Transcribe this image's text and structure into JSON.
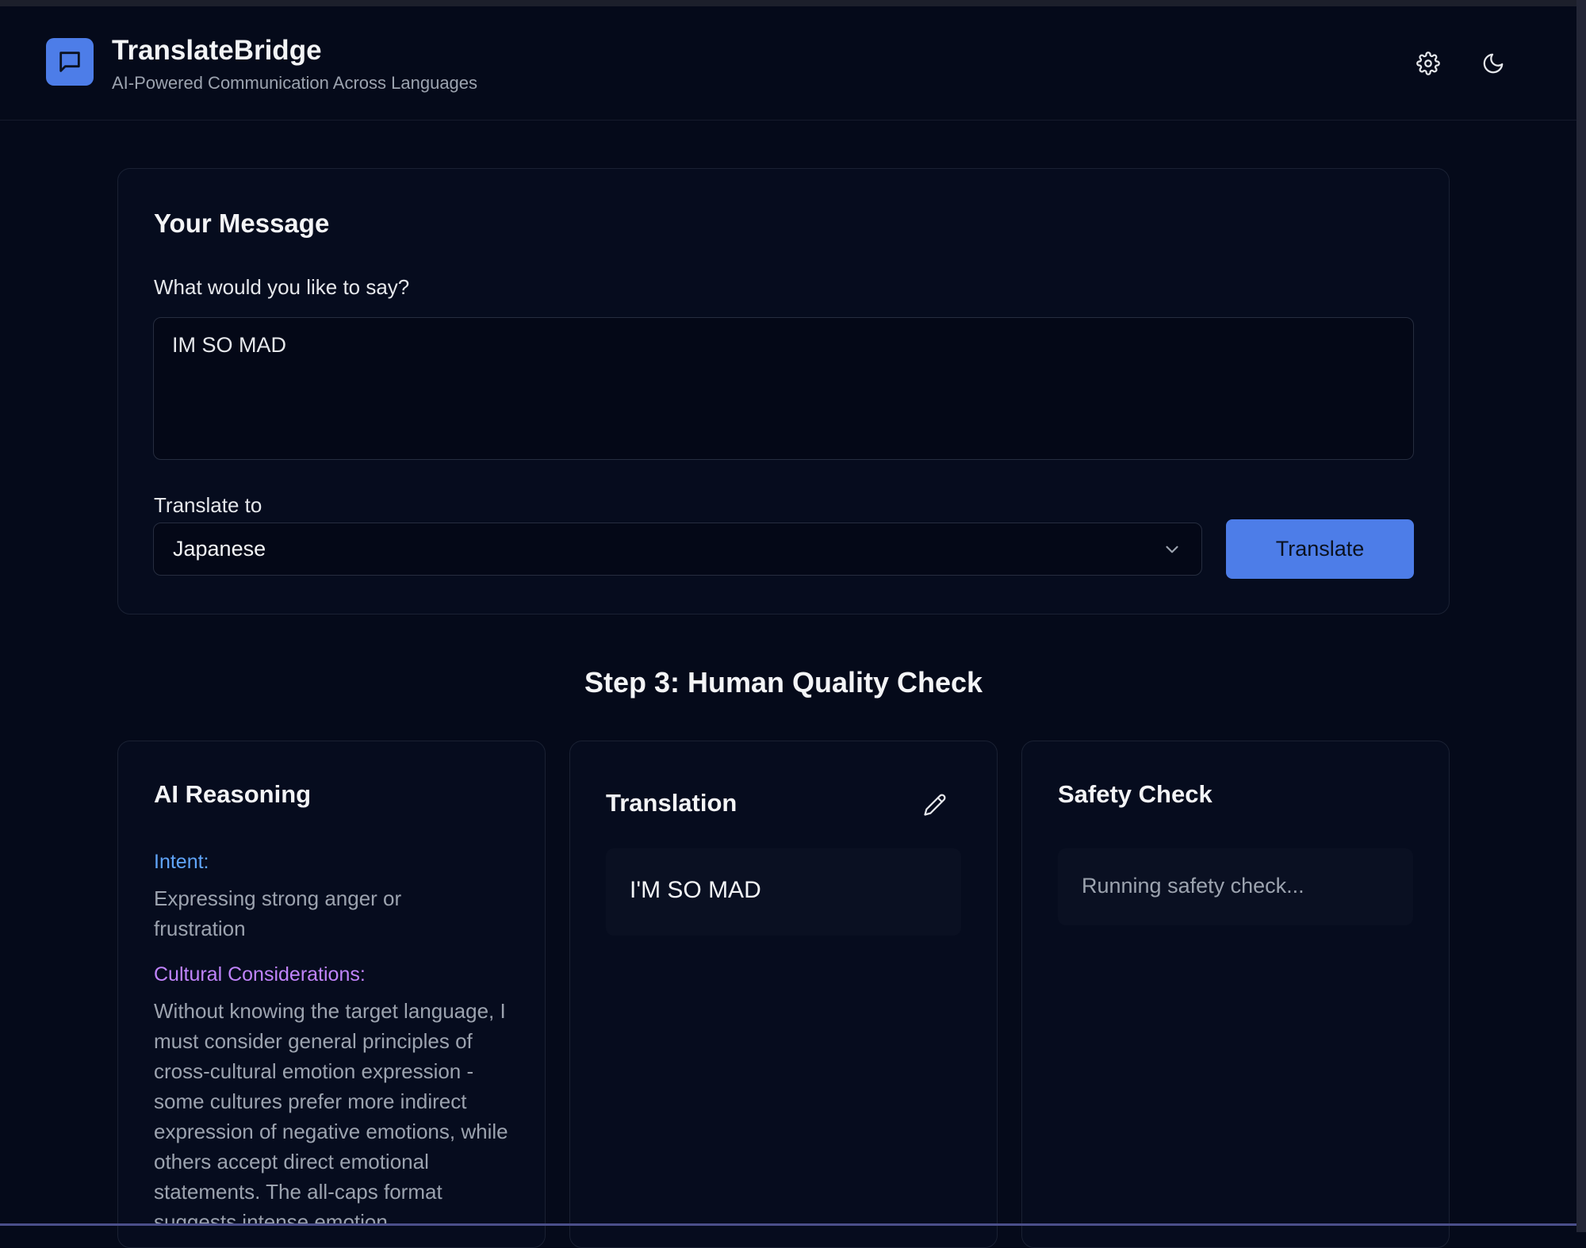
{
  "app": {
    "title": "TranslateBridge",
    "subtitle": "AI-Powered Communication Across Languages"
  },
  "header": {
    "icons": [
      "chat-bubble-icon",
      "gear-icon",
      "moon-icon"
    ]
  },
  "message_card": {
    "title": "Your Message",
    "prompt_label": "What would you like to say?",
    "message_value": "IM SO MAD",
    "translate_to_label": "Translate to",
    "selected_language": "Japanese",
    "translate_button": "Translate"
  },
  "step": {
    "title": "Step 3: Human Quality Check"
  },
  "reasoning_card": {
    "title": "AI Reasoning",
    "intent_heading": "Intent:",
    "intent_text": "Expressing strong anger or frustration",
    "cultural_heading": "Cultural Considerations:",
    "cultural_text": "Without knowing the target language, I must consider general principles of cross-cultural emotion expression - some cultures prefer more indirect expression of negative emotions, while others accept direct emotional statements. The all-caps format suggests intense emotion"
  },
  "translation_card": {
    "title": "Translation",
    "translated_text": "I'M SO MAD"
  },
  "safety_card": {
    "title": "Safety Check",
    "status_text": "Running safety check..."
  },
  "colors": {
    "background": "#050a1a",
    "accent": "#4d7de8",
    "intent_heading": "#60a5fa",
    "cultural_heading": "#c084fc"
  }
}
